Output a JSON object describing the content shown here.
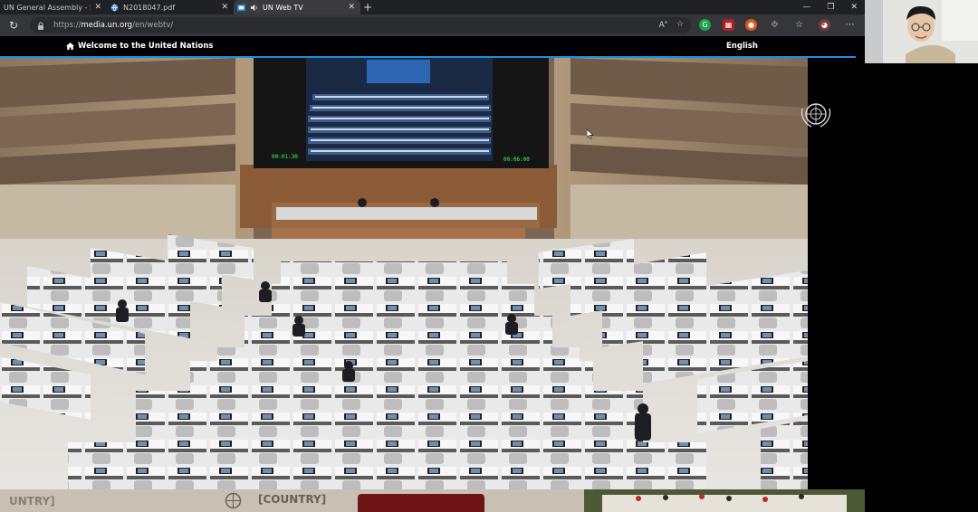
{
  "browser": {
    "tabs": [
      {
        "label": "UN General Assembly - Schedule",
        "active": false,
        "icon": "un-globe-icon"
      },
      {
        "label": "N2018047.pdf",
        "active": false,
        "icon": "pdf-globe-icon"
      },
      {
        "label": "UN Web TV",
        "active": true,
        "icon": "un-web-tv-icon"
      }
    ],
    "url_prefix": "https://",
    "url_host": "media.un.org",
    "url_path": "/en/webtv/"
  },
  "site": {
    "welcome": "Welcome to the United Nations",
    "language": "English"
  },
  "video": {
    "screen_time_left": "00:01:30",
    "screen_time_right": "00:06:00"
  },
  "bottom": {
    "placard_left": "UNTRY]",
    "placard_right": "[COUNTRY]"
  },
  "colors": {
    "tabbar": "#202124",
    "addressbar": "#35363a",
    "accent_blue": "#1d8ee0",
    "header_bg": "#000000"
  }
}
